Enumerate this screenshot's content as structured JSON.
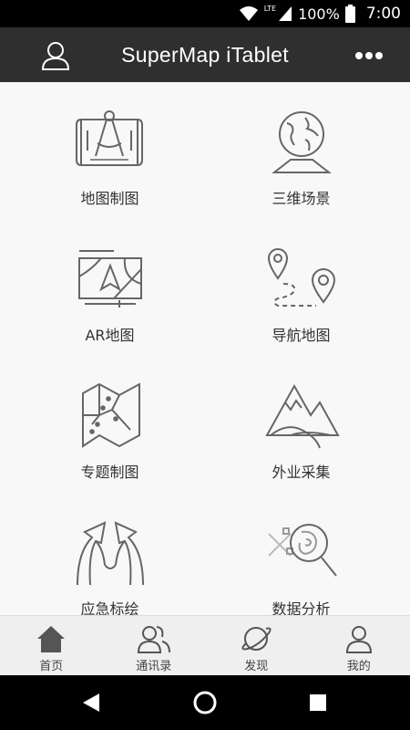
{
  "status": {
    "network": "LTE",
    "battery": "100%",
    "time": "7:00"
  },
  "appbar": {
    "title": "SuperMap iTablet"
  },
  "tiles": [
    {
      "label": "地图制图",
      "icon": "map-drafting-icon"
    },
    {
      "label": "三维场景",
      "icon": "3d-globe-icon"
    },
    {
      "label": "AR地图",
      "icon": "ar-map-icon"
    },
    {
      "label": "导航地图",
      "icon": "navigation-route-icon"
    },
    {
      "label": "专题制图",
      "icon": "thematic-map-icon"
    },
    {
      "label": "外业采集",
      "icon": "mountain-field-icon"
    },
    {
      "label": "应急标绘",
      "icon": "emergency-arrows-icon"
    },
    {
      "label": "数据分析",
      "icon": "data-analysis-icon"
    }
  ],
  "bottomnav": [
    {
      "label": "首页",
      "icon": "home-icon"
    },
    {
      "label": "通讯录",
      "icon": "contacts-icon"
    },
    {
      "label": "发现",
      "icon": "planet-icon"
    },
    {
      "label": "我的",
      "icon": "person-icon"
    }
  ],
  "colors": {
    "appbar": "#2f2f2f",
    "background": "#f8f8f8",
    "icon_stroke": "#666666"
  }
}
